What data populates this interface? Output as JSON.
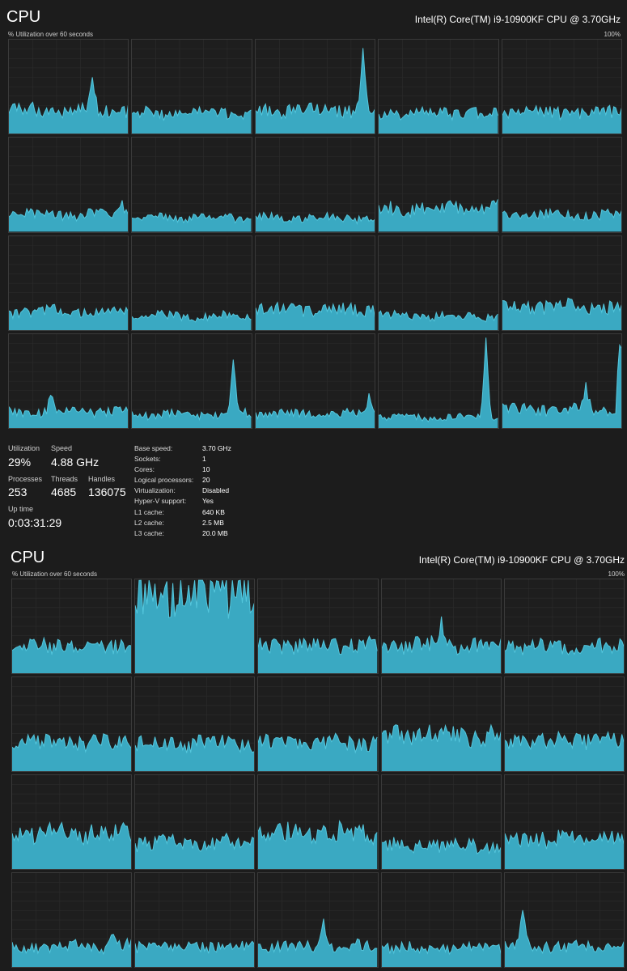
{
  "panel1": {
    "title": "CPU",
    "cpu_name": "Intel(R) Core(TM) i9-10900KF CPU @ 3.70GHz",
    "graph_caption": "% Utilization over 60 seconds",
    "max_label": "100%"
  },
  "stats": {
    "utilization": {
      "label": "Utilization",
      "value": "29%"
    },
    "speed": {
      "label": "Speed",
      "value": "4.88 GHz"
    },
    "processes": {
      "label": "Processes",
      "value": "253"
    },
    "threads": {
      "label": "Threads",
      "value": "4685"
    },
    "handles": {
      "label": "Handles",
      "value": "136075"
    },
    "uptime": {
      "label": "Up time",
      "value": "0:03:31:29"
    }
  },
  "specs": [
    {
      "key": "Base speed:",
      "value": "3.70 GHz"
    },
    {
      "key": "Sockets:",
      "value": "1"
    },
    {
      "key": "Cores:",
      "value": "10"
    },
    {
      "key": "Logical processors:",
      "value": "20"
    },
    {
      "key": "Virtualization:",
      "value": "Disabled"
    },
    {
      "key": "Hyper-V support:",
      "value": "Yes"
    },
    {
      "key": "L1 cache:",
      "value": "640 KB"
    },
    {
      "key": "L2 cache:",
      "value": "2.5 MB"
    },
    {
      "key": "L3 cache:",
      "value": "20.0 MB"
    }
  ],
  "panel2": {
    "title": "CPU",
    "cpu_name": "Intel(R) Core(TM) i9-10900KF CPU @ 3.70GHz",
    "graph_caption": "% Utilization over 60 seconds",
    "max_label": "100%"
  },
  "colors": {
    "graph_fill": "#3aa9c2",
    "graph_line": "#54c6dc",
    "grid": "#2c2c2c",
    "border": "#3a3a3a"
  },
  "chart_data": [
    {
      "type": "area",
      "title": "% Utilization over 60 seconds",
      "ylim": [
        0,
        100
      ],
      "grid": true,
      "series_profiles": [
        {
          "name": "",
          "level": 25,
          "spikes": [
            [
              0.7,
              35
            ]
          ]
        },
        {
          "name": "",
          "level": 22,
          "spikes": []
        },
        {
          "name": "",
          "level": 25,
          "spikes": [
            [
              0.9,
              70
            ]
          ]
        },
        {
          "name": "",
          "level": 22,
          "spikes": []
        },
        {
          "name": "",
          "level": 22,
          "spikes": []
        },
        {
          "name": "",
          "level": 18,
          "spikes": [
            [
              0.95,
              15
            ]
          ]
        },
        {
          "name": "",
          "level": 15,
          "spikes": []
        },
        {
          "name": "",
          "level": 15,
          "spikes": []
        },
        {
          "name": "",
          "level": 25,
          "spikes": []
        },
        {
          "name": "",
          "level": 18,
          "spikes": []
        },
        {
          "name": "",
          "level": 20,
          "spikes": []
        },
        {
          "name": "",
          "level": 15,
          "spikes": []
        },
        {
          "name": "",
          "level": 22,
          "spikes": []
        },
        {
          "name": "",
          "level": 15,
          "spikes": []
        },
        {
          "name": "",
          "level": 25,
          "spikes": []
        },
        {
          "name": "",
          "level": 18,
          "spikes": [
            [
              0.35,
              15
            ]
          ]
        },
        {
          "name": "",
          "level": 15,
          "spikes": [
            [
              0.85,
              55
            ]
          ]
        },
        {
          "name": "",
          "level": 15,
          "spikes": [
            [
              0.95,
              20
            ]
          ]
        },
        {
          "name": "",
          "level": 12,
          "spikes": [
            [
              0.9,
              85
            ]
          ]
        },
        {
          "name": "",
          "level": 20,
          "spikes": [
            [
              0.7,
              25
            ],
            [
              0.99,
              90
            ]
          ]
        }
      ]
    },
    {
      "type": "area",
      "title": "% Utilization over 60 seconds",
      "ylim": [
        0,
        100
      ],
      "grid": true,
      "series_profiles": [
        {
          "name": "",
          "level": 30,
          "spikes": []
        },
        {
          "name": "",
          "level": 85,
          "spikes": []
        },
        {
          "name": "",
          "level": 30,
          "spikes": []
        },
        {
          "name": "",
          "level": 30,
          "spikes": [
            [
              0.5,
              25
            ]
          ]
        },
        {
          "name": "",
          "level": 28,
          "spikes": []
        },
        {
          "name": "",
          "level": 30,
          "spikes": []
        },
        {
          "name": "",
          "level": 30,
          "spikes": []
        },
        {
          "name": "",
          "level": 30,
          "spikes": []
        },
        {
          "name": "",
          "level": 38,
          "spikes": []
        },
        {
          "name": "",
          "level": 32,
          "spikes": []
        },
        {
          "name": "",
          "level": 38,
          "spikes": []
        },
        {
          "name": "",
          "level": 28,
          "spikes": []
        },
        {
          "name": "",
          "level": 38,
          "spikes": []
        },
        {
          "name": "",
          "level": 25,
          "spikes": []
        },
        {
          "name": "",
          "level": 32,
          "spikes": []
        },
        {
          "name": "",
          "level": 22,
          "spikes": [
            [
              0.85,
              18
            ]
          ]
        },
        {
          "name": "",
          "level": 22,
          "spikes": []
        },
        {
          "name": "",
          "level": 22,
          "spikes": [
            [
              0.55,
              25
            ]
          ]
        },
        {
          "name": "",
          "level": 20,
          "spikes": []
        },
        {
          "name": "",
          "level": 22,
          "spikes": [
            [
              0.15,
              35
            ]
          ]
        }
      ]
    }
  ]
}
